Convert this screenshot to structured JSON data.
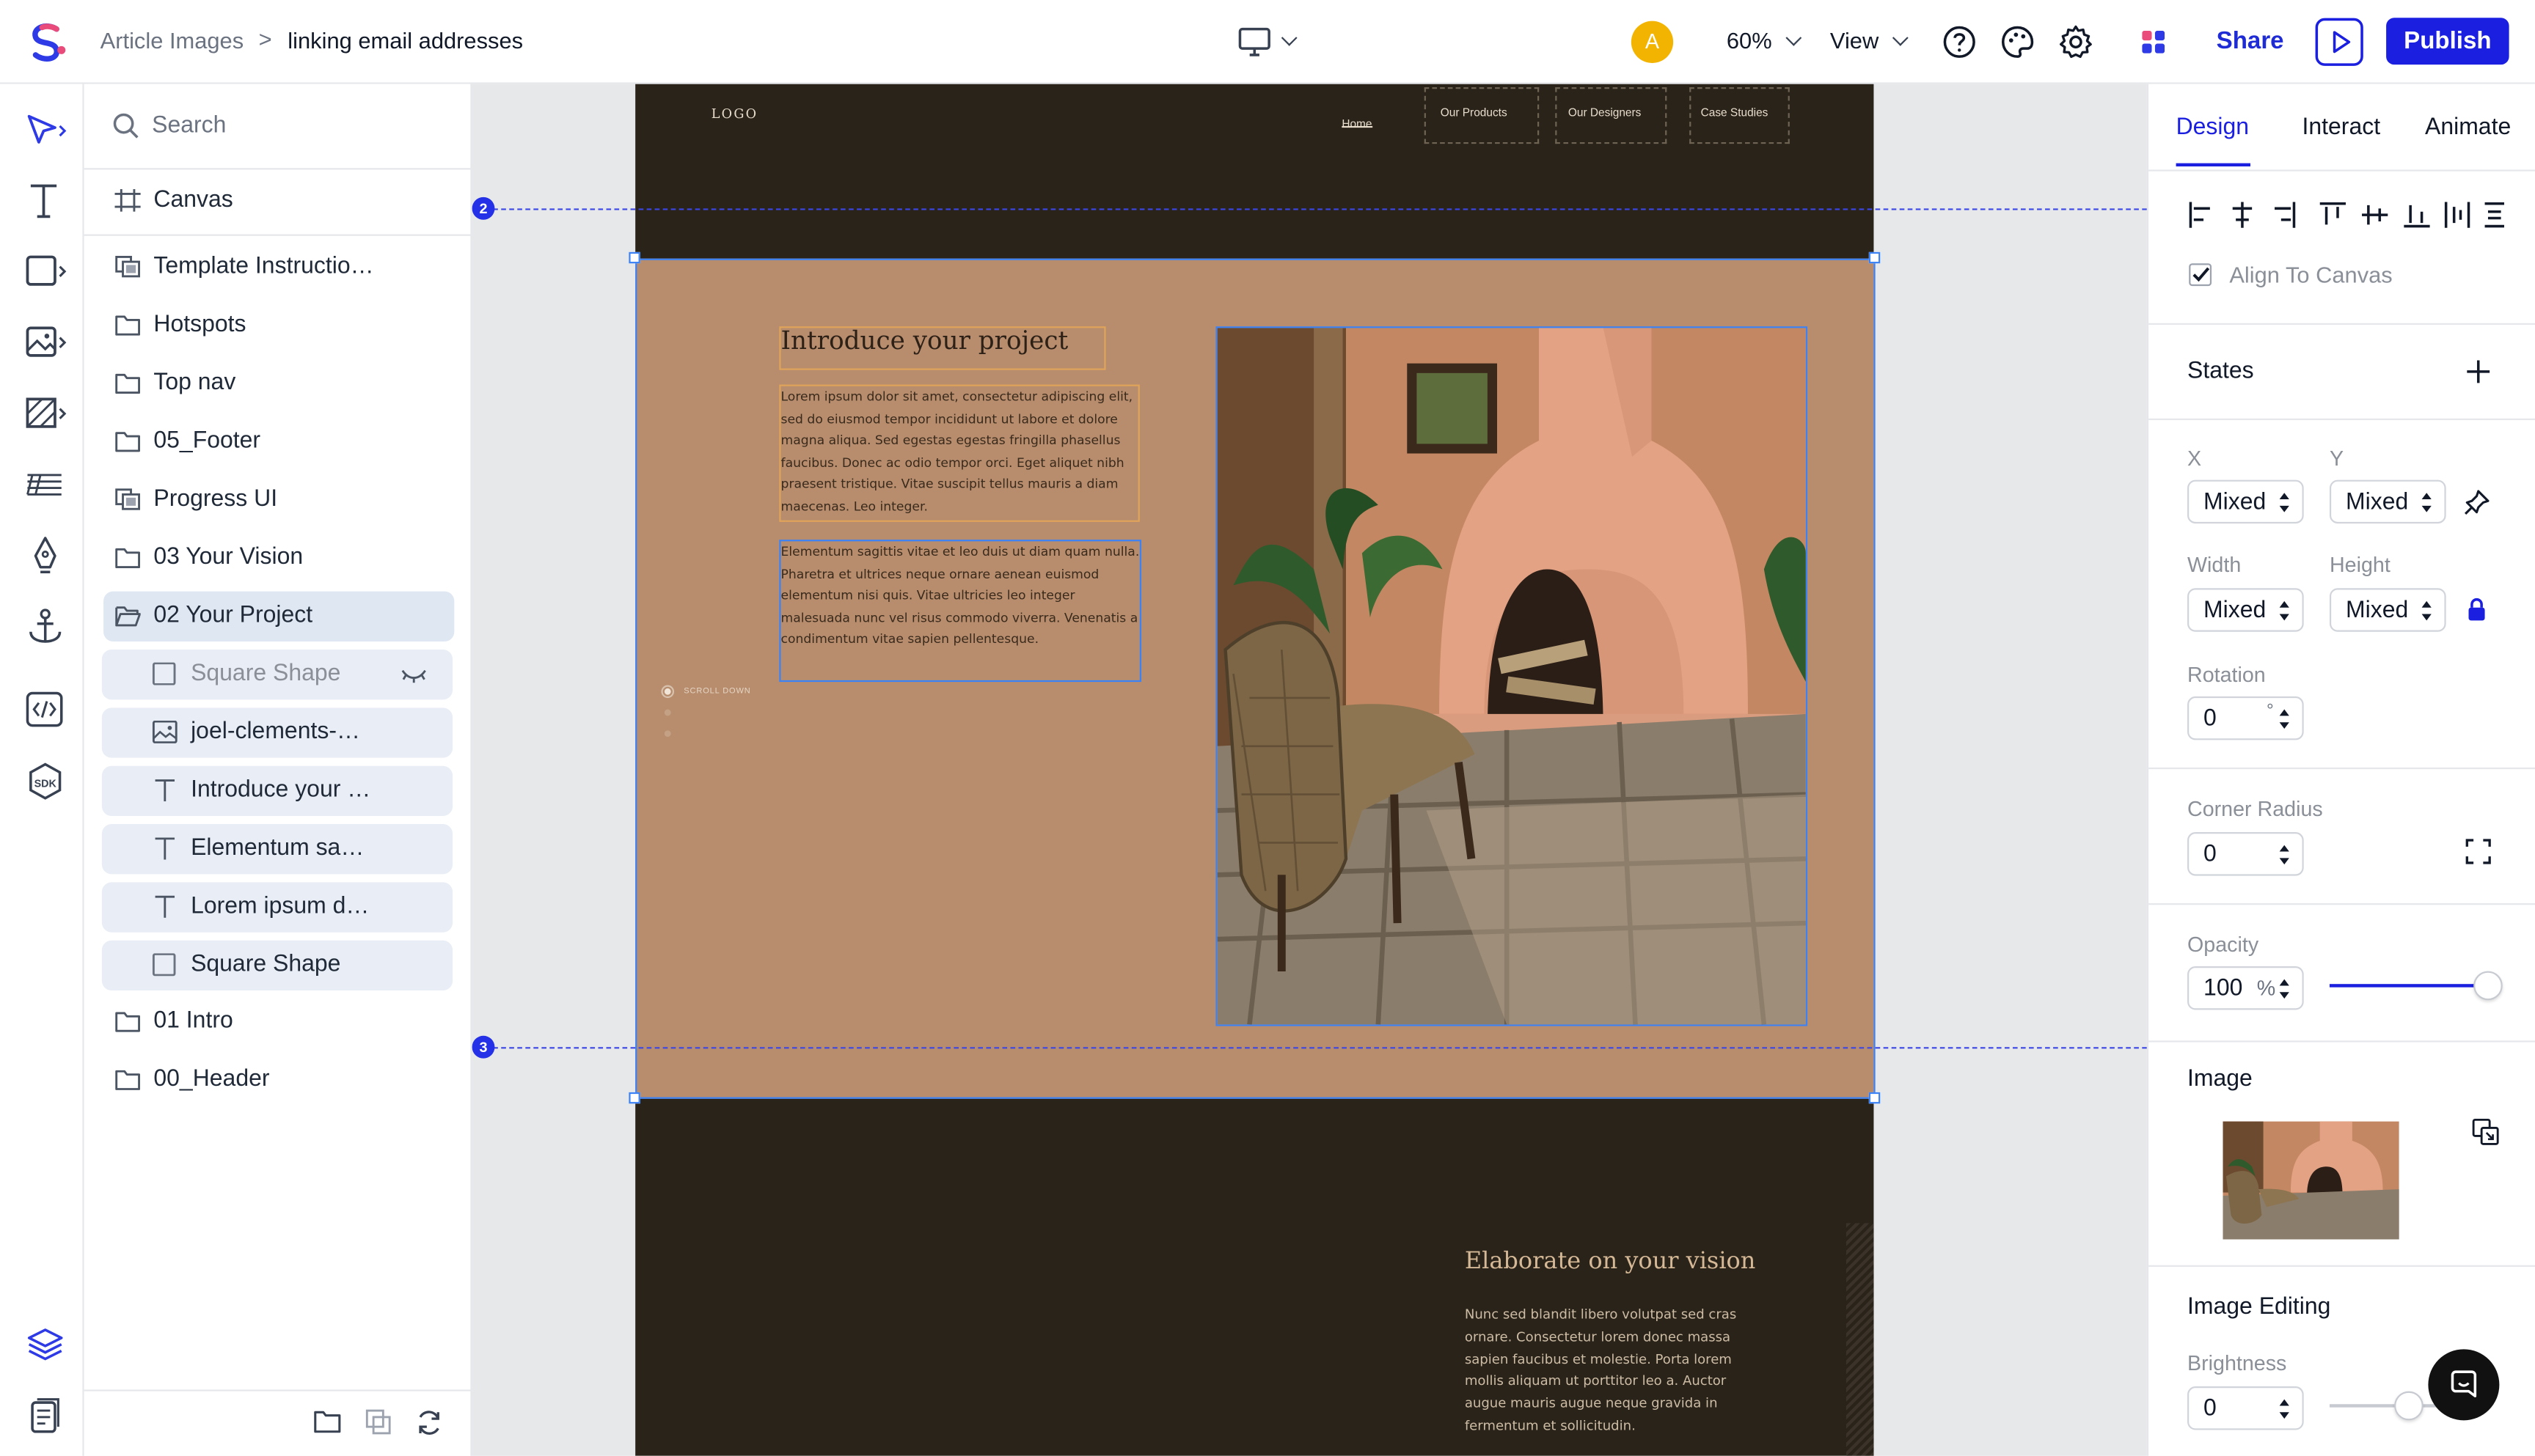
{
  "breadcrumb": {
    "project": "Article Images",
    "separator": ">",
    "page": "linking email addresses"
  },
  "toolbar": {
    "avatar_initial": "A",
    "zoom": "60%",
    "view_label": "View",
    "share_label": "Share",
    "publish_label": "Publish"
  },
  "layers_panel": {
    "search_placeholder": "Search",
    "canvas_label": "Canvas",
    "items": [
      {
        "label": "Template Instructio…",
        "icon": "component-icon"
      },
      {
        "label": "Hotspots",
        "icon": "folder-icon"
      },
      {
        "label": "Top nav",
        "icon": "folder-icon"
      },
      {
        "label": "05_Footer",
        "icon": "folder-icon"
      },
      {
        "label": "Progress UI",
        "icon": "component-icon"
      },
      {
        "label": "03 Your Vision",
        "icon": "folder-icon"
      },
      {
        "label": "02 Your Project",
        "icon": "folder-open-icon"
      }
    ],
    "children": [
      {
        "label": "Square Shape",
        "icon": "square-icon"
      },
      {
        "label": "joel-clements-…",
        "icon": "image-icon"
      },
      {
        "label": "Introduce your …",
        "icon": "text-icon"
      },
      {
        "label": "Elementum sa…",
        "icon": "text-icon"
      },
      {
        "label": "Lorem ipsum d…",
        "icon": "text-icon"
      },
      {
        "label": "Square Shape",
        "icon": "square-icon"
      }
    ],
    "after": [
      {
        "label": "01 Intro",
        "icon": "folder-icon"
      },
      {
        "label": "00_Header",
        "icon": "folder-icon"
      }
    ]
  },
  "design": {
    "logo": "LOGO",
    "nav": [
      "Home",
      "Our Products",
      "Our Designers",
      "Case Studies"
    ],
    "guide_badges": [
      "2",
      "3"
    ],
    "heading": "Introduce your project",
    "para1": "Lorem ipsum dolor sit amet, consectetur adipiscing elit, sed do eiusmod tempor incididunt ut labore et dolore magna aliqua. Sed egestas egestas fringilla phasellus faucibus. Donec ac odio tempor orci. Eget aliquet nibh praesent tristique. Vitae suscipit tellus mauris a diam maecenas. Leo integer.",
    "para2": "Elementum sagittis vitae et leo duis ut diam quam nulla. Pharetra et ultrices neque ornare aenean euismod elementum nisi quis. Vitae ultricies leo integer malesuada nunc vel risus commodo viverra. Venenatis a condimentum vitae sapien pellentesque.",
    "scroll": "SCROLL DOWN",
    "vision_heading": "Elaborate on your vision",
    "vision_text": "Nunc sed blandit libero volutpat sed cras ornare. Consectetur lorem donec massa sapien faucibus et molestie. Porta lorem mollis aliquam ut porttitor leo a. Auctor augue mauris augue neque gravida in fermentum et sollicitudin."
  },
  "props": {
    "tabs": [
      "Design",
      "Interact",
      "Animate"
    ],
    "align_to_canvas": "Align To Canvas",
    "states": "States",
    "x_label": "X",
    "y_label": "Y",
    "x_value": "Mixed",
    "y_value": "Mixed",
    "width_label": "Width",
    "height_label": "Height",
    "width_value": "Mixed",
    "height_value": "Mixed",
    "rotation_label": "Rotation",
    "rotation_value": "0",
    "rotation_unit": "°",
    "corner_label": "Corner Radius",
    "corner_value": "0",
    "opacity_label": "Opacity",
    "opacity_value": "100",
    "opacity_unit": "%",
    "opacity_level": 1.0,
    "image_label": "Image",
    "image_editing_label": "Image Editing",
    "brightness_label": "Brightness",
    "brightness_value": "0",
    "brightness_level": 0.5
  },
  "colors": {
    "accent": "#1a1fe0",
    "page_dark": "#2a231a",
    "page_tan": "#b78d6d"
  }
}
